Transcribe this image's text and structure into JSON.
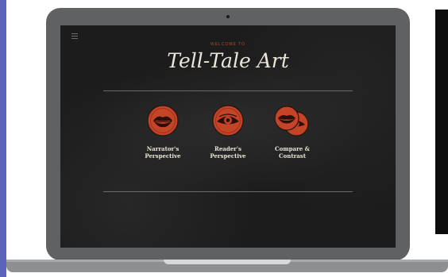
{
  "screen": {
    "welcome": "WELCOME TO",
    "title": "Tell-Tale Art",
    "menu_icon": "hamburger-menu-icon"
  },
  "options": [
    {
      "label_line1": "Narrator's",
      "label_line2": "Perspective",
      "icon": "mouth-icon"
    },
    {
      "label_line1": "Reader's",
      "label_line2": "Perspective",
      "icon": "eye-icon"
    },
    {
      "label_line1": "Compare &",
      "label_line2": "Contrast",
      "icon": "mouth-and-eye-icon"
    }
  ],
  "colors": {
    "accent": "#c1472f",
    "disc_fill": "#c44428",
    "laptop_frame": "#606163",
    "left_strip": "#5b64b8"
  }
}
